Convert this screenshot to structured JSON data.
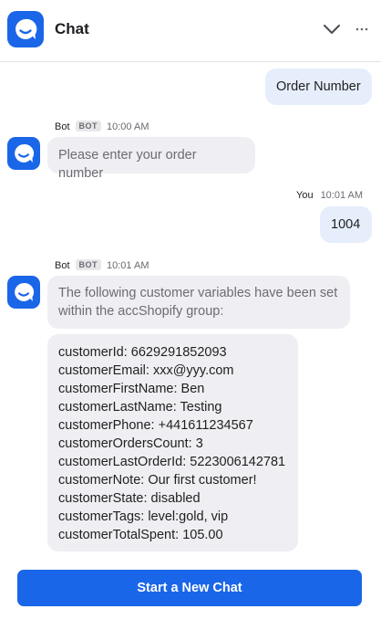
{
  "header": {
    "title": "Chat",
    "icons": {
      "brand": "chat-bubble-icon",
      "collapse": "chevron-down-icon",
      "more": "more-horizontal-icon"
    }
  },
  "messages": [
    {
      "from": "user",
      "text": "Order Number"
    },
    {
      "from": "bot",
      "sender": "Bot",
      "badge": "BOT",
      "time": "10:00 AM",
      "text": "Please enter your order number"
    },
    {
      "from": "user",
      "sender": "You",
      "time": "10:01 AM",
      "text": "1004"
    },
    {
      "from": "bot",
      "sender": "Bot",
      "badge": "BOT",
      "time": "10:01 AM",
      "intro_line1": "The following customer variables have been set",
      "intro_line2": "within the accShopify group:",
      "variables": [
        "customerId: 6629291852093",
        "customerEmail: xxx@yyy.com",
        "customerFirstName: Ben",
        "customerLastName: Testing",
        "customerPhone: +441611234567",
        "customerOrdersCount: 3",
        "customerLastOrderId: 5223006142781",
        "customerNote: Our first customer!",
        "customerState: disabled",
        "customerTags: level:gold, vip",
        "customerTotalSpent: 105.00"
      ]
    }
  ],
  "footer": {
    "new_chat_label": "Start a New Chat"
  },
  "colors": {
    "accent": "#1a66e8",
    "user_bubble": "#e6eefc",
    "bot_bubble": "#efeff3"
  }
}
